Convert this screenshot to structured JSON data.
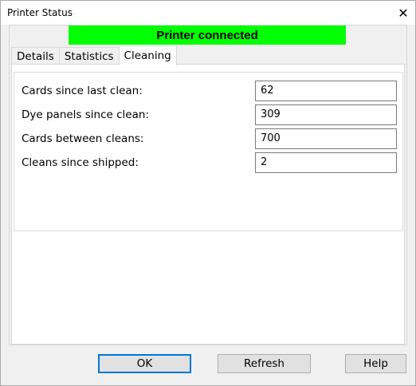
{
  "window": {
    "title": "Printer Status",
    "close_glyph": "✕"
  },
  "status": {
    "text": "Printer connected",
    "color": "#00ff00"
  },
  "tabs": [
    {
      "label": "Details",
      "active": false
    },
    {
      "label": "Statistics",
      "active": false
    },
    {
      "label": "Cleaning",
      "active": true
    }
  ],
  "cleaning": {
    "rows": [
      {
        "label": "Cards since last clean:",
        "value": "62"
      },
      {
        "label": "Dye panels since clean:",
        "value": "309"
      },
      {
        "label": "Cards between cleans:",
        "value": "700"
      },
      {
        "label": "Cleans since shipped:",
        "value": "2"
      }
    ]
  },
  "buttons": {
    "ok": "OK",
    "refresh": "Refresh",
    "help": "Help"
  },
  "colors": {
    "accent": "#0078d7"
  }
}
